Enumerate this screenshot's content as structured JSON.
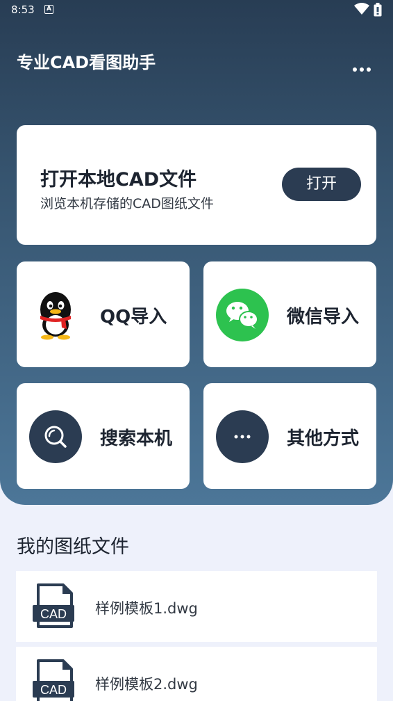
{
  "status_bar": {
    "time": "8:53",
    "notification_icon": "A"
  },
  "header": {
    "title": "专业CAD看图助手",
    "more_icon": "more-dots-icon"
  },
  "open_card": {
    "title": "打开本地CAD文件",
    "subtitle": "浏览本机存储的CAD图纸文件",
    "button_label": "打开"
  },
  "tiles": [
    {
      "label": "QQ导入",
      "icon": "qq-penguin-icon"
    },
    {
      "label": "微信导入",
      "icon": "wechat-icon"
    },
    {
      "label": "搜索本机",
      "icon": "search-icon"
    },
    {
      "label": "其他方式",
      "icon": "more-dots-icon"
    }
  ],
  "files_section": {
    "title": "我的图纸文件",
    "icon_text": "CAD",
    "files": [
      {
        "name": "样例模板1.dwg"
      },
      {
        "name": "样例模板2.dwg"
      }
    ]
  },
  "colors": {
    "header_top": "#283d54",
    "header_bottom": "#4c7698",
    "accent_dark": "#2b3c52",
    "wechat_green": "#2dc24f",
    "background": "#eef1fb"
  }
}
